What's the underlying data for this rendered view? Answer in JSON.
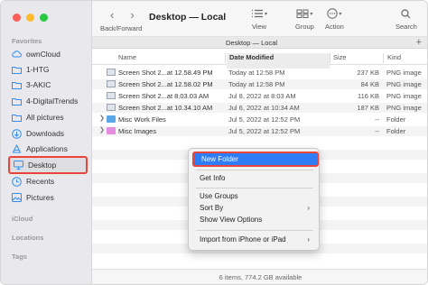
{
  "sidebar": {
    "favorites_label": "Favorites",
    "icloud_label": "iCloud",
    "locations_label": "Locations",
    "tags_label": "Tags",
    "items": [
      {
        "label": "ownCloud",
        "icon": "cloud-icon"
      },
      {
        "label": "1-HTG",
        "icon": "folder-icon"
      },
      {
        "label": "3-AKIC",
        "icon": "folder-icon"
      },
      {
        "label": "4-DigitalTrends",
        "icon": "folder-icon"
      },
      {
        "label": "All pictures",
        "icon": "folder-icon"
      },
      {
        "label": "Downloads",
        "icon": "download-icon"
      },
      {
        "label": "Applications",
        "icon": "applications-icon"
      },
      {
        "label": "Desktop",
        "icon": "desktop-icon"
      },
      {
        "label": "Recents",
        "icon": "clock-icon"
      },
      {
        "label": "Pictures",
        "icon": "pictures-icon"
      }
    ]
  },
  "toolbar": {
    "back_forward_label": "Back/Forward",
    "title": "Desktop — Local",
    "view_label": "View",
    "group_label": "Group",
    "action_label": "Action",
    "search_label": "Search"
  },
  "tabbar": {
    "title": "Desktop — Local",
    "add_tab": "+"
  },
  "columns": {
    "name": "Name",
    "date": "Date Modified",
    "size": "Size",
    "kind": "Kind"
  },
  "files": [
    {
      "name": "Screen Shot 2...at 12.58.49 PM",
      "date": "Today at 12:58 PM",
      "size": "237 KB",
      "kind": "PNG image",
      "type": "image"
    },
    {
      "name": "Screen Shot 2...at 12.58.02 PM",
      "date": "Today at 12:58 PM",
      "size": "84 KB",
      "kind": "PNG image",
      "type": "image"
    },
    {
      "name": "Screen Shot 2...at 8.03.03 AM",
      "date": "Jul 8, 2022 at 8:03 AM",
      "size": "116 KB",
      "kind": "PNG image",
      "type": "image"
    },
    {
      "name": "Screen Shot 2...at 10.34.10 AM",
      "date": "Jul 6, 2022 at 10:34 AM",
      "size": "187 KB",
      "kind": "PNG image",
      "type": "image"
    },
    {
      "name": "Misc Work Files",
      "date": "Jul 5, 2022 at 12:52 PM",
      "size": "--",
      "kind": "Folder",
      "type": "folder",
      "color": "#5aa7e8"
    },
    {
      "name": "Misc Images",
      "date": "Jul 5, 2022 at 12:52 PM",
      "size": "--",
      "kind": "Folder",
      "type": "folder",
      "color": "#e58be0"
    }
  ],
  "context_menu": {
    "new_folder": "New Folder",
    "get_info": "Get Info",
    "use_groups": "Use Groups",
    "sort_by": "Sort By",
    "show_view_options": "Show View Options",
    "import_from_iphone": "Import from iPhone or iPad"
  },
  "status": {
    "text": "6 items, 774.2 GB available"
  },
  "colors": {
    "accent": "#2f7df6",
    "highlight_border": "#e8463b"
  }
}
